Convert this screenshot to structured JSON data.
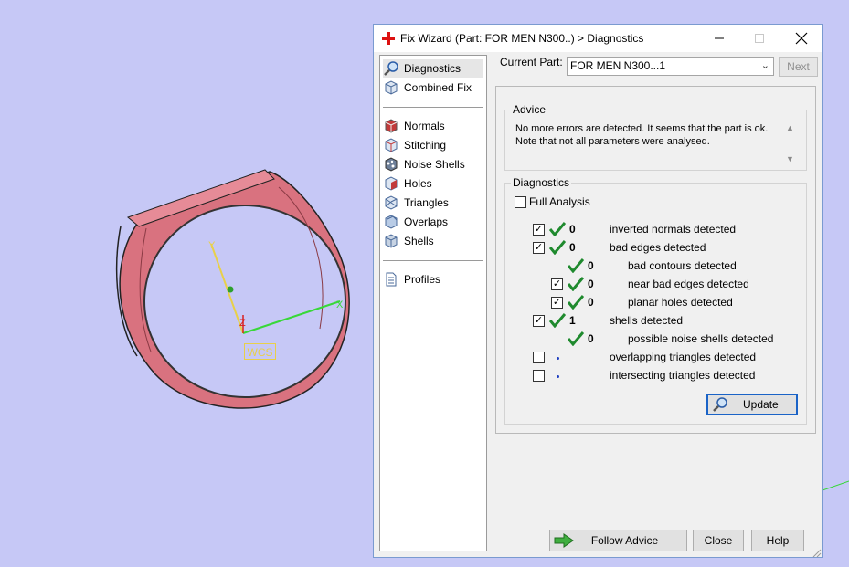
{
  "viewport": {
    "wcs_label": "WCS",
    "axis_y": "Y",
    "axis_z": "Z",
    "axis_x": "X"
  },
  "dialog": {
    "title": "Fix Wizard (Part: FOR MEN N300..) > Diagnostics",
    "nav": {
      "top": [
        "Diagnostics",
        "Combined Fix"
      ],
      "tools": [
        "Normals",
        "Stitching",
        "Noise Shells",
        "Holes",
        "Triangles",
        "Overlaps",
        "Shells"
      ],
      "bottom": [
        "Profiles"
      ]
    },
    "current_part_label": "Current Part:",
    "current_part_value": "FOR MEN N300...1",
    "next_label": "Next",
    "advice": {
      "legend": "Advice",
      "line1": "No more errors are detected. It seems that the part is ok.",
      "line2": "Note that not all parameters were analysed."
    },
    "diagnostics": {
      "legend": "Diagnostics",
      "full_analysis_label": "Full Analysis",
      "rows": [
        {
          "checked": true,
          "count": "0",
          "label": "inverted normals detected"
        },
        {
          "checked": true,
          "count": "0",
          "label": "bad edges detected"
        },
        {
          "checked": null,
          "count": "0",
          "label": "bad contours detected"
        },
        {
          "checked": true,
          "count": "0",
          "label": "near bad edges detected"
        },
        {
          "checked": true,
          "count": "0",
          "label": "planar holes detected"
        },
        {
          "checked": true,
          "count": "1",
          "label": "shells detected"
        },
        {
          "checked": null,
          "count": "0",
          "label": "possible noise shells detected"
        },
        {
          "checked": false,
          "count": "",
          "label": "overlapping triangles detected"
        },
        {
          "checked": false,
          "count": "",
          "label": "intersecting triangles detected"
        }
      ],
      "update_label": "Update"
    },
    "buttons": {
      "follow_advice": "Follow Advice",
      "close": "Close",
      "help": "Help"
    }
  },
  "colors": {
    "background": "#c6c8f6",
    "ring": "#d9727f",
    "check_green": "#1f8a2e",
    "accent_blue": "#1a63c7"
  }
}
